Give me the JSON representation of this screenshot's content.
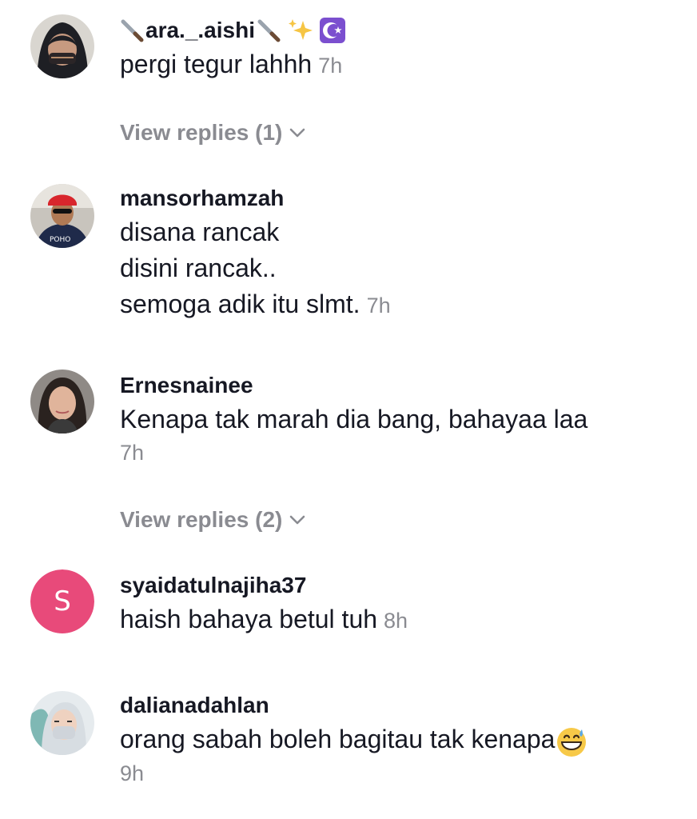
{
  "comments": [
    {
      "username": "ara._.aishi",
      "lines": [
        "pergi tegur lahhh"
      ],
      "time": "7h",
      "replies_label": "View replies (1)"
    },
    {
      "username": "mansorhamzah",
      "lines": [
        "disana rancak",
        "disini rancak..",
        "semoga adik itu slmt."
      ],
      "time": "7h"
    },
    {
      "username": "Ernesnainee",
      "lines": [
        "Kenapa tak marah dia bang, bahayaa laa"
      ],
      "time": "7h",
      "replies_label": "View replies (2)"
    },
    {
      "username": "syaidatulnajiha37",
      "avatar_letter": "S",
      "lines": [
        "haish bahaya betul tuh"
      ],
      "time": "8h"
    },
    {
      "username": "dalianadahlan",
      "lines": [
        "orang sabah boleh bagitau tak kenapa"
      ],
      "time": "9h"
    }
  ],
  "icons": {
    "username_decorations": [
      "knife-icon",
      "knife-icon",
      "sparkles-icon",
      "star-and-crescent-icon"
    ],
    "chevron": "chevron-down-icon",
    "emoji": "grinning-sweat-emoji-icon"
  },
  "colors": {
    "username": "#161823",
    "body_text": "#161823",
    "muted": "#8a8b91",
    "letter_avatar_bg": "#e84a7a",
    "crescent_bg": "#7b4fcf"
  }
}
